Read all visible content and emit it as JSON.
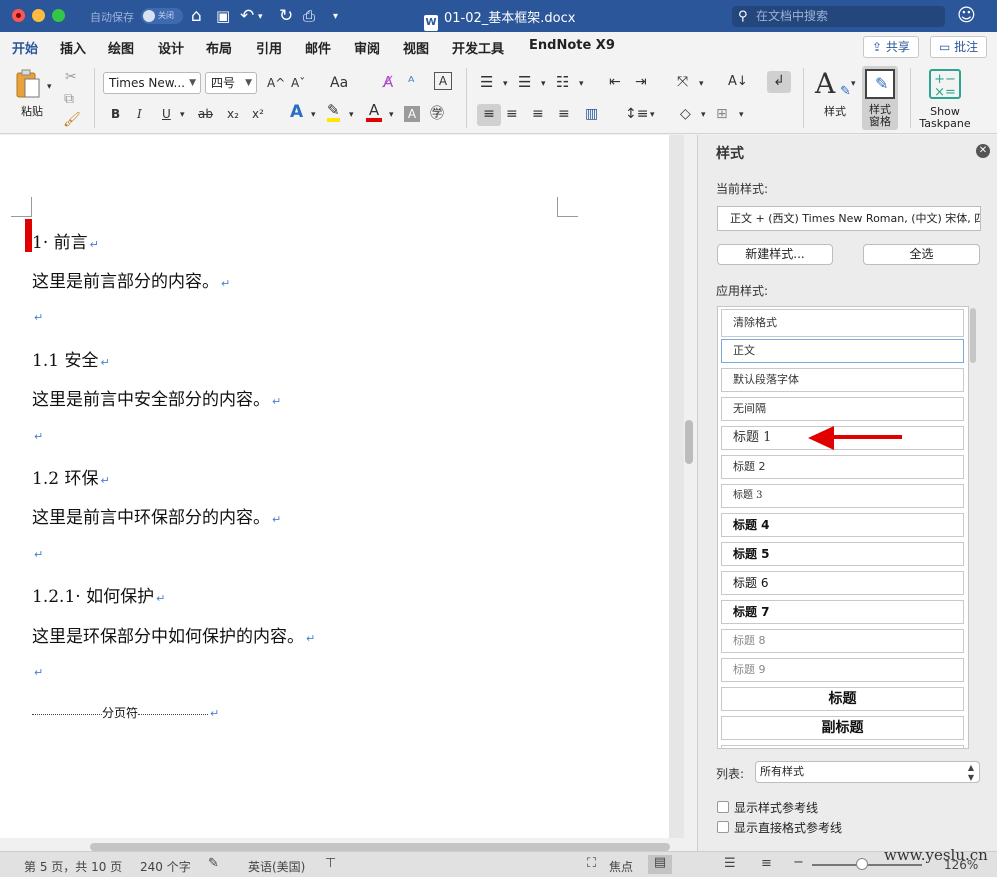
{
  "window": {
    "autosave_label": "自动保存",
    "autosave_state": "关闭",
    "document_title": "01-02_基本框架.docx",
    "search_placeholder": "在文档中搜索"
  },
  "tabs": [
    "开始",
    "插入",
    "绘图",
    "设计",
    "布局",
    "引用",
    "邮件",
    "审阅",
    "视图",
    "开发工具",
    "EndNote X9"
  ],
  "header_buttons": {
    "share": "共享",
    "comments": "批注"
  },
  "ribbon": {
    "paste_label": "粘贴",
    "font_name": "Times New...",
    "font_size": "四号",
    "bold": "B",
    "italic": "I",
    "underline": "U",
    "strike": "ab",
    "subscript": "x₂",
    "superscript": "x²",
    "grow_font": "A^",
    "shrink_font": "Aˇ",
    "change_case": "Aa",
    "styles_label": "样式",
    "styles_pane_label": "样式\n窗格",
    "styles_pane_line1": "样式",
    "styles_pane_line2": "窗格",
    "show_taskpane_line1": "Show",
    "show_taskpane_line2": "Taskpane"
  },
  "document": {
    "paragraphs": [
      "1· 前言",
      "这里是前言部分的内容。",
      "",
      "1.1 安全",
      "这里是前言中安全部分的内容。",
      "",
      "1.2 环保",
      "这里是前言中环保部分的内容。",
      "",
      "1.2.1· 如何保护",
      "这里是环保部分中如何保护的内容。",
      ""
    ],
    "page_break_label": "分页符",
    "paragraph_mark": "↵"
  },
  "styles_pane": {
    "title": "样式",
    "current_style_label": "当前样式:",
    "current_style_value": "正文 + (西文) Times New Roman, (中文) 宋体, 四号",
    "new_style_button": "新建样式...",
    "select_all_button": "全选",
    "apply_style_label": "应用样式:",
    "styles": [
      "清除格式",
      "正文",
      "默认段落字体",
      "无间隔",
      "标题 1",
      "标题 2",
      "标题 3",
      "标题 4",
      "标题 5",
      "标题 6",
      "标题 7",
      "标题 8",
      "标题 9",
      "标题",
      "副标题"
    ],
    "list_label": "列表:",
    "list_value": "所有样式",
    "show_guides_label": "显示样式参考线",
    "show_direct_guides_label": "显示直接格式参考线",
    "arrow_color": "#e00000"
  },
  "status": {
    "page": "第 5 页，共 10 页",
    "words": "240 个字",
    "language": "英语(美国)",
    "focus": "焦点",
    "zoom": "126%"
  },
  "watermark": "www.yeslu.cn",
  "colors": {
    "accent": "#2b579a",
    "highlight": "#ffe600",
    "font_color": "#e00000"
  }
}
